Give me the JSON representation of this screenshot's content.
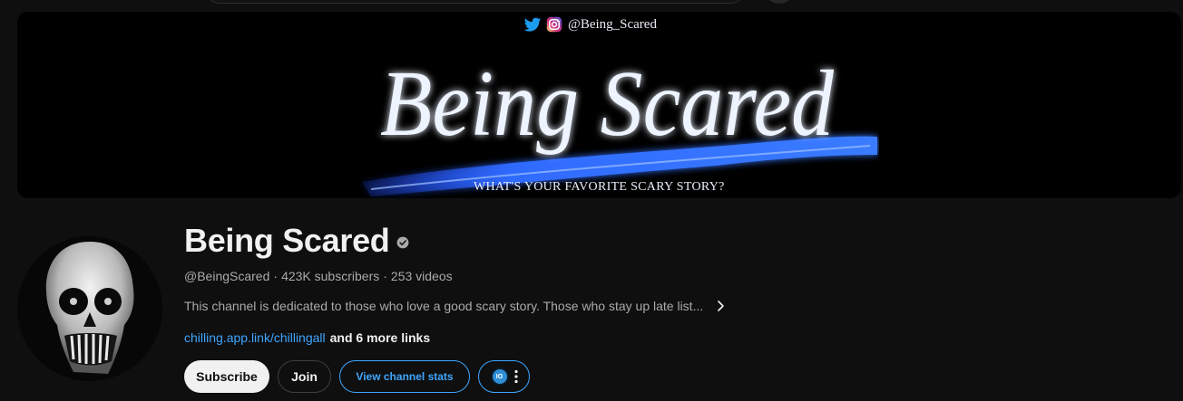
{
  "banner": {
    "handle": "@Being_Scared",
    "wordmark": "Being Scared",
    "tagline": "WHAT'S YOUR FAVORITE SCARY STORY?",
    "icons": [
      "twitter-icon",
      "instagram-icon"
    ]
  },
  "channel": {
    "name": "Being Scared",
    "verified_icon": "verified-check-icon",
    "handle": "@BeingScared",
    "separator": "·",
    "subscribers": "423K subscribers",
    "videos": "253 videos",
    "description": "This channel is dedicated to those who love a good scary story. Those who stay up late list...",
    "link": "chilling.app.link/chillingall",
    "more_links": "and 6 more links"
  },
  "actions": {
    "subscribe": "Subscribe",
    "join": "Join",
    "stats": "View channel stats",
    "extension_logo": "IO"
  },
  "colors": {
    "background": "#0f0f0f",
    "text_primary": "#f1f1f1",
    "text_secondary": "#aaaaaa",
    "link_blue": "#3ea6ff",
    "subscribe_bg": "#f1f1f1",
    "banner_glow": "#2f6bff"
  }
}
